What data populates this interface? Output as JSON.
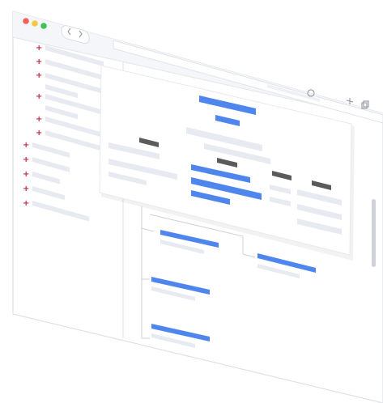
{
  "window": {
    "controls": {
      "close_color": "#f25f5c",
      "minimize_color": "#f7c744",
      "maximize_color": "#3fc25a"
    },
    "nav": {
      "back_icon": "chevron-left-icon",
      "forward_icon": "chevron-right-icon"
    },
    "toolbar": {
      "reload_icon": "reload-icon",
      "new_tab_icon": "plus-icon",
      "copy_icon": "copy-icon"
    }
  },
  "sidebar": {
    "expand_icon": "plus-icon",
    "expand_color": "#c8284a",
    "item_count": 12
  },
  "colors": {
    "accent": "#4f86ee",
    "placeholder": "#e8eaf1",
    "dark_block": "#5b5b5b",
    "window_frame": "#dfe1e7"
  }
}
